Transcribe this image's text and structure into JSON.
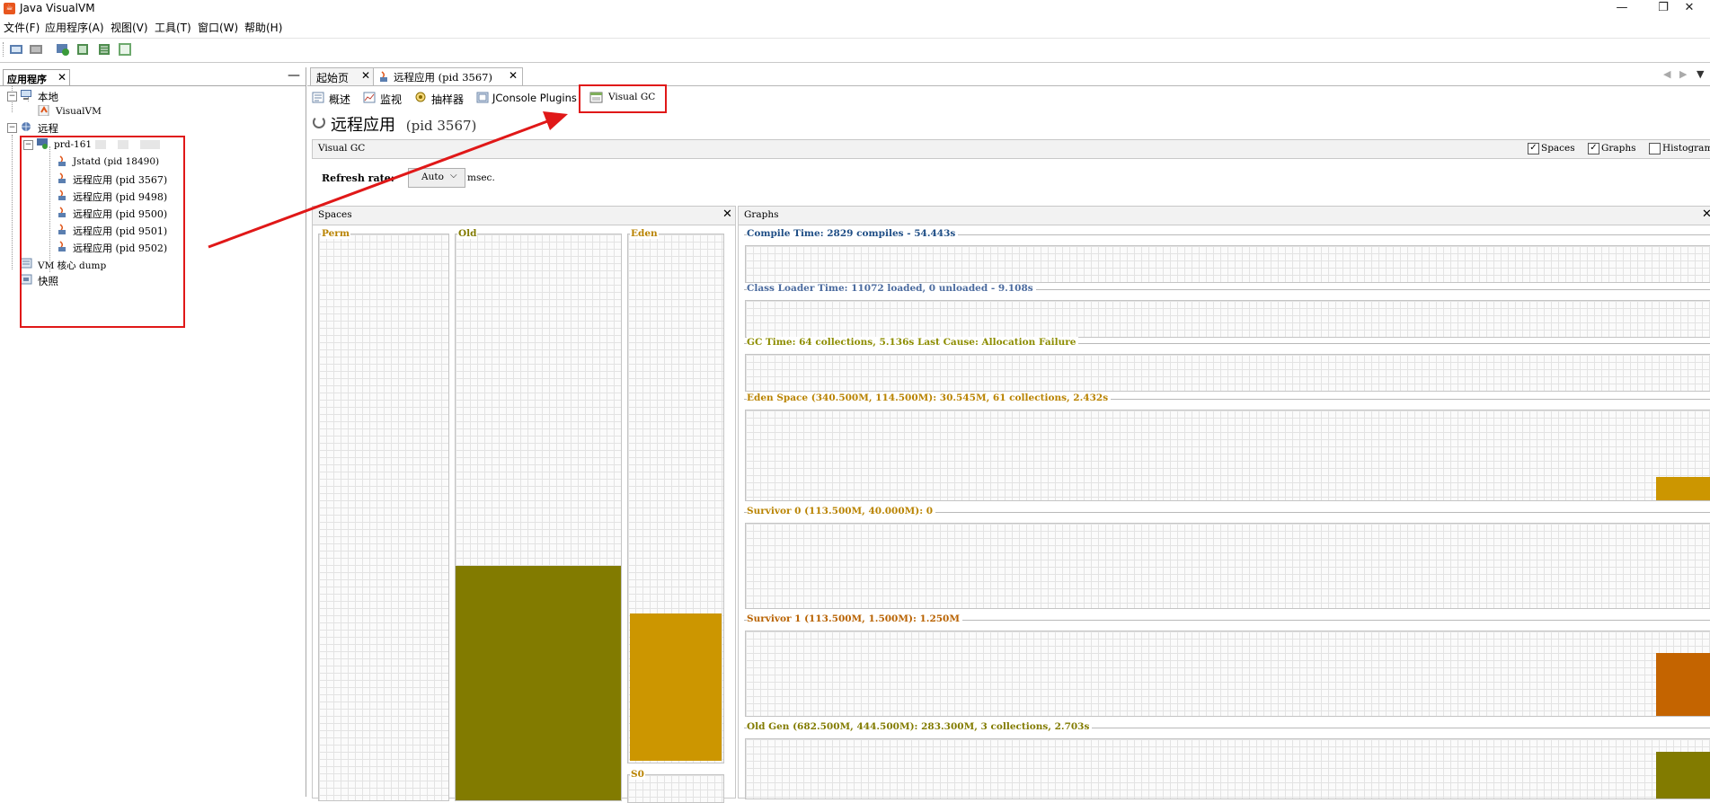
{
  "window": {
    "title": "Java VisualVM",
    "controls": [
      "—",
      "❐",
      "✕"
    ]
  },
  "menu": [
    "文件(F)",
    "应用程序(A)",
    "视图(V)",
    "工具(T)",
    "窗口(W)",
    "帮助(H)"
  ],
  "toolbar": {
    "icons": [
      "add-application-icon",
      "add-host-icon",
      "add-jmx-icon",
      "heap-dump-icon",
      "thread-dump-icon",
      "snapshot-icon"
    ]
  },
  "left_panel": {
    "tab_label": "应用程序",
    "tree": {
      "local": "本地",
      "visualvm": "VisualVM",
      "remote": "远程",
      "host": "prd-161",
      "children": [
        "Jstatd (pid 18490)",
        "远程应用 (pid 3567)",
        "远程应用 (pid 9498)",
        "远程应用 (pid 9500)",
        "远程应用 (pid 9501)",
        "远程应用 (pid 9502)"
      ],
      "core_dump": "VM 核心 dump",
      "snapshots": "快照"
    }
  },
  "doc_tabs": [
    "起始页",
    "远程应用 (pid 3567)"
  ],
  "sub_tabs": [
    "概述",
    "监视",
    "抽样器",
    "JConsole Plugins",
    "Visual GC"
  ],
  "header": {
    "title": "远程应用",
    "pid": "(pid 3567)",
    "section": "Visual GC",
    "checkboxes": [
      {
        "label": "Spaces",
        "checked": true
      },
      {
        "label": "Graphs",
        "checked": true
      },
      {
        "label": "Histogram",
        "checked": false
      }
    ],
    "refresh_label": "Refresh rate:",
    "refresh_value": "Auto",
    "refresh_unit": "msec."
  },
  "spaces": {
    "title": "Spaces",
    "perm": "Perm",
    "old": "Old",
    "eden": "Eden",
    "s0": "S0",
    "colors": {
      "old": "#827b00",
      "eden": "#cc9600"
    },
    "fill": {
      "old": 0.415,
      "eden": 0.279
    }
  },
  "graphs": {
    "title": "Graphs",
    "items": [
      {
        "label": "Compile Time: 2829 compiles - 54.443s",
        "color": "#1f4e86"
      },
      {
        "label": "Class Loader Time: 11072 loaded, 0 unloaded - 9.108s",
        "color": "#4a6a9e"
      },
      {
        "label": "GC Time: 64 collections, 5.136s  Last Cause: Allocation Failure",
        "color": "#8d8d00"
      },
      {
        "label": "Eden Space (340.500M, 114.500M): 30.545M, 61 collections, 2.432s",
        "color": "#b98300"
      },
      {
        "label": "Survivor 0 (113.500M, 40.000M): 0",
        "color": "#b98300"
      },
      {
        "label": "Survivor 1 (113.500M, 1.500M): 1.250M",
        "color": "#b86200"
      },
      {
        "label": "Old Gen (682.500M, 444.500M): 283.300M, 3 collections, 2.703s",
        "color": "#827b00"
      }
    ]
  }
}
